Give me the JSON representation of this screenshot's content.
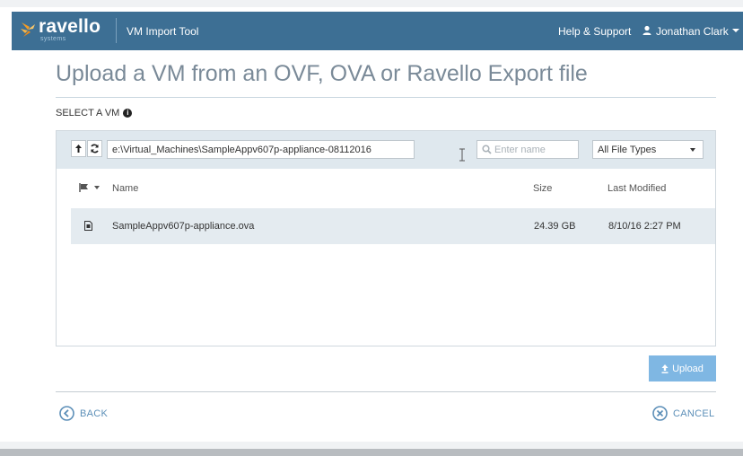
{
  "header": {
    "brand": "ravello",
    "brand_sub": "systems",
    "app_title": "VM Import Tool",
    "help_link": "Help & Support",
    "user_name": "Jonathan Clark"
  },
  "page": {
    "title": "Upload a VM from an OVF, OVA or Ravello Export file",
    "select_label": "SELECT A VM"
  },
  "toolbar": {
    "path_value": "e:\\Virtual_Machines\\SampleAppv607p-appliance-08112016",
    "search_placeholder": "Enter name",
    "file_type_selected": "All File Types"
  },
  "table": {
    "columns": {
      "name": "Name",
      "size": "Size",
      "modified": "Last Modified"
    },
    "rows": [
      {
        "name": "SampleAppv607p-appliance.ova",
        "size": "24.39 GB",
        "modified": "8/10/16 2:27 PM"
      }
    ]
  },
  "actions": {
    "upload_label": "Upload",
    "back_label": "BACK",
    "cancel_label": "CANCEL"
  },
  "colors": {
    "header_bg": "#3d6f94",
    "accent": "#5c8fb8",
    "upload_button": "#7fb7e3",
    "logo_orange": "#f39c24"
  }
}
